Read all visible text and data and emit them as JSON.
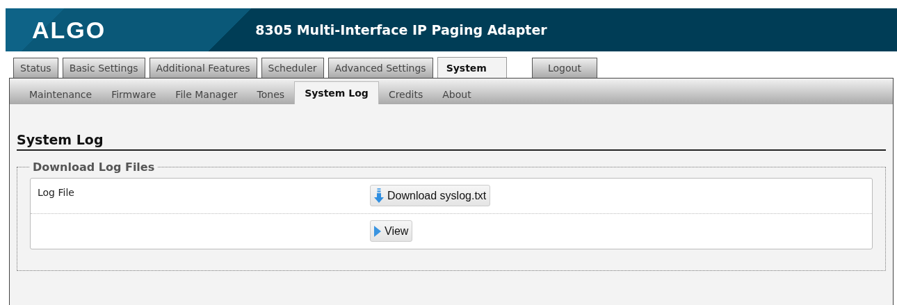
{
  "header": {
    "logo": "ALGO",
    "title": "8305 Multi-Interface IP Paging Adapter"
  },
  "tabs": [
    {
      "label": "Status",
      "selected": false,
      "kind": "page"
    },
    {
      "label": "Basic Settings",
      "selected": false,
      "kind": "page"
    },
    {
      "label": "Additional Features",
      "selected": false,
      "kind": "page"
    },
    {
      "label": "Scheduler",
      "selected": false,
      "kind": "page"
    },
    {
      "label": "Advanced Settings",
      "selected": false,
      "kind": "page"
    },
    {
      "label": "System",
      "selected": true,
      "kind": "page"
    },
    {
      "label": "Logout",
      "selected": false,
      "kind": "action"
    }
  ],
  "subtabs": [
    {
      "label": "Maintenance",
      "selected": false
    },
    {
      "label": "Firmware",
      "selected": false
    },
    {
      "label": "File Manager",
      "selected": false
    },
    {
      "label": "Tones",
      "selected": false
    },
    {
      "label": "System Log",
      "selected": true
    },
    {
      "label": "Credits",
      "selected": false
    },
    {
      "label": "About",
      "selected": false
    }
  ],
  "section": {
    "title": "System Log",
    "group": "Download Log Files",
    "rows": [
      {
        "label": "Log File",
        "button": {
          "label": "Download syslog.txt",
          "kind": "download"
        }
      },
      {
        "button": {
          "label": "View",
          "kind": "view"
        }
      }
    ]
  }
}
